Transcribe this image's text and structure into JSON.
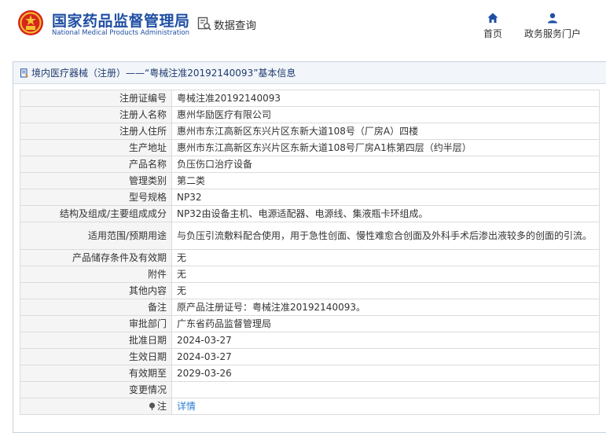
{
  "header": {
    "title_cn": "国家药品监督管理局",
    "title_en": "National Medical Products Administration",
    "query_label": "数据查询",
    "nav": [
      {
        "label": "首页",
        "icon": "home-icon"
      },
      {
        "label": "政务服务门户",
        "icon": "user-icon"
      }
    ]
  },
  "panel": {
    "breadcrumb": "境内医疗器械（注册）——“粤械注准20192140093”基本信息"
  },
  "rows": [
    {
      "key": "注册证编号",
      "value": "粤械注准20192140093"
    },
    {
      "key": "注册人名称",
      "value": "惠州华励医疗有限公司"
    },
    {
      "key": "注册人住所",
      "value": "惠州市东江高新区东兴片区东新大道108号（厂房A）四楼"
    },
    {
      "key": "生产地址",
      "value": "惠州市东江高新区东兴片区东新大道108号厂房A1栋第四层（约半层）"
    },
    {
      "key": "产品名称",
      "value": "负压伤口治疗设备"
    },
    {
      "key": "管理类别",
      "value": "第二类"
    },
    {
      "key": "型号规格",
      "value": "NP32"
    },
    {
      "key": "结构及组成/主要组成成分",
      "value": "NP32由设备主机、电源适配器、电源线、集液瓶卡环组成。"
    },
    {
      "key": "适用范围/预期用途",
      "value": "与负压引流敷料配合使用，用于急性创面、慢性难愈合创面及外科手术后渗出液较多的创面的引流。"
    },
    {
      "key": "产品储存条件及有效期",
      "value": "无"
    },
    {
      "key": "附件",
      "value": "无"
    },
    {
      "key": "其他内容",
      "value": "无"
    },
    {
      "key": "备注",
      "value": "原产品注册证号：粤械注准20192140093。"
    },
    {
      "key": "审批部门",
      "value": "广东省药品监督管理局"
    },
    {
      "key": "批准日期",
      "value": "2024-03-27"
    },
    {
      "key": "生效日期",
      "value": "2024-03-27"
    },
    {
      "key": "有效期至",
      "value": "2029-03-26"
    },
    {
      "key": "变更情况",
      "value": ""
    },
    {
      "key": "注",
      "value": "详情"
    }
  ],
  "colors": {
    "brand_blue": "#1f4fa3",
    "link": "#2a7ed3",
    "label_bg": "#f5f5f5"
  }
}
